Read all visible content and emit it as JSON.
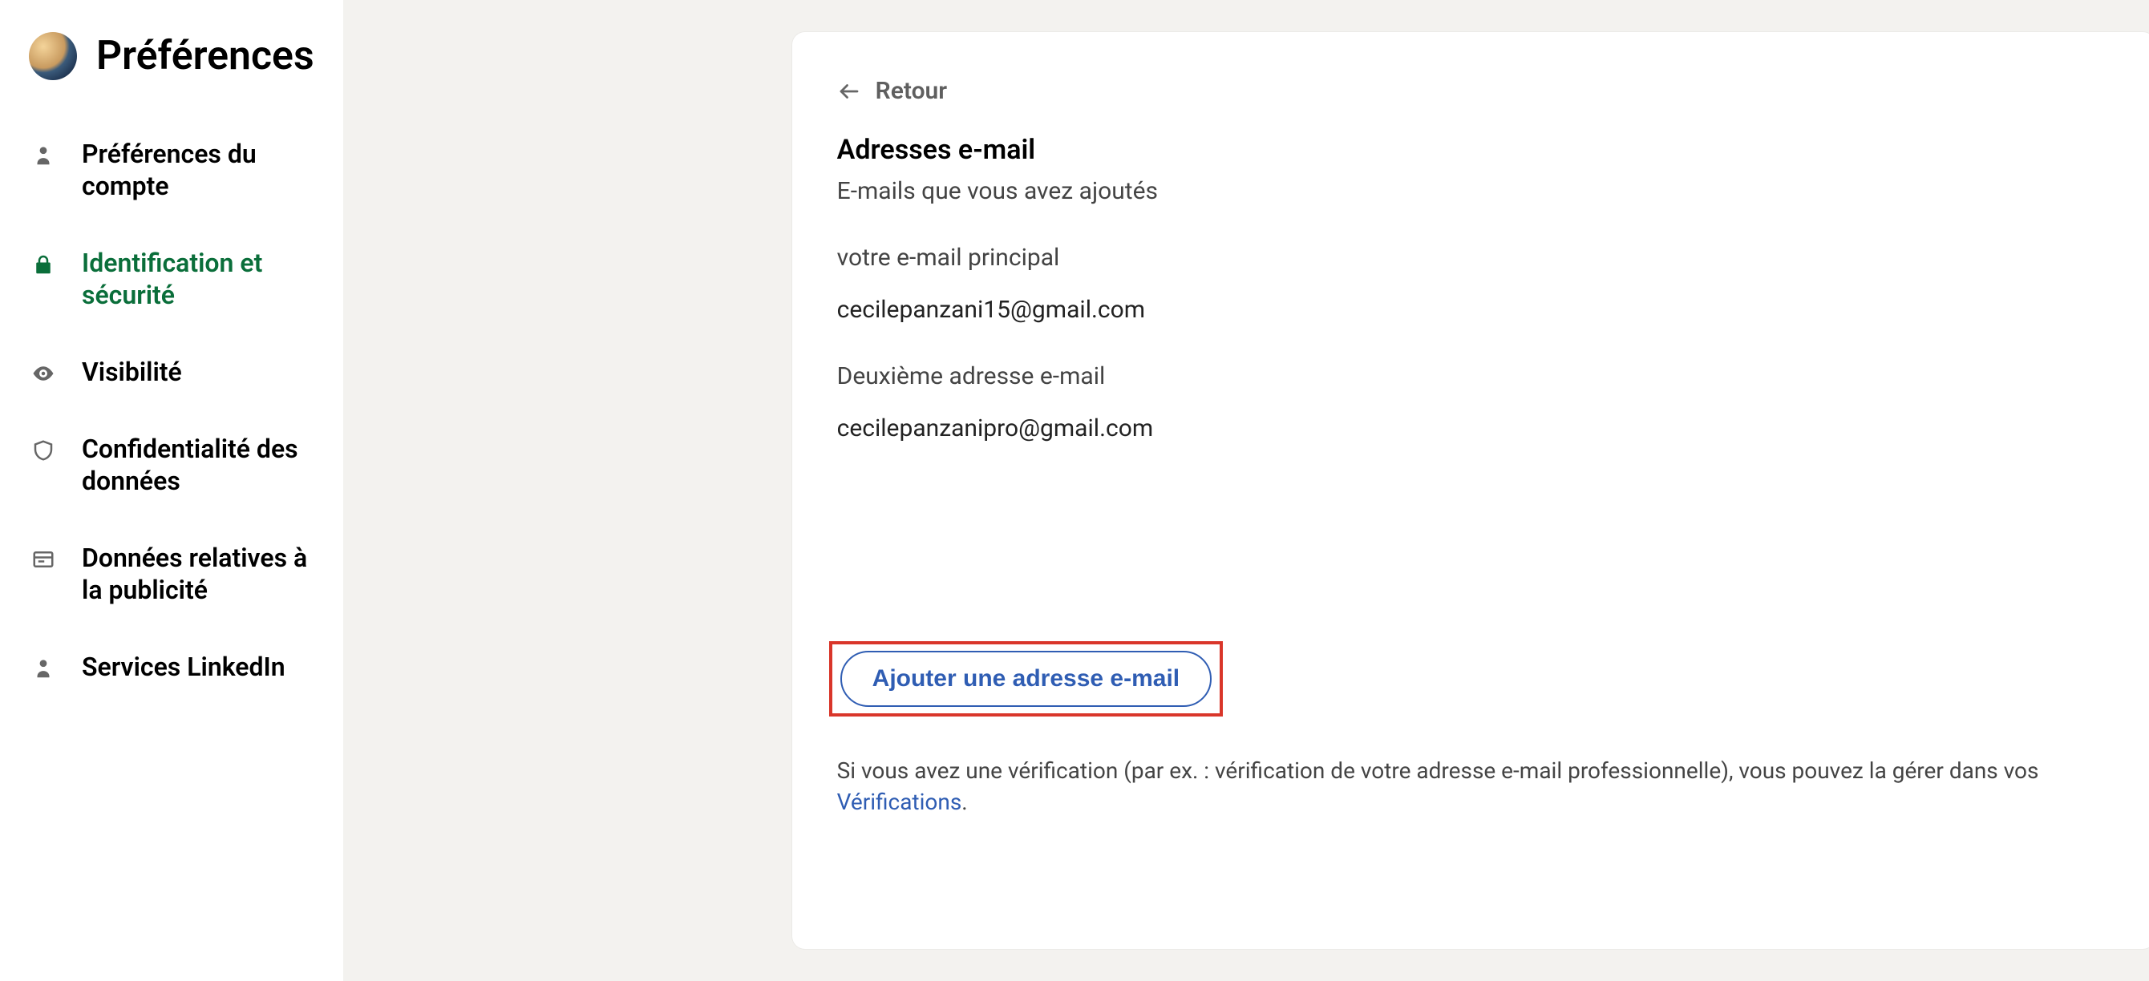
{
  "page_title": "Préférences",
  "sidebar": {
    "items": [
      {
        "label": "Préférences du compte"
      },
      {
        "label": "Identification et sécurité"
      },
      {
        "label": "Visibilité"
      },
      {
        "label": "Confidentialité des données"
      },
      {
        "label": "Données relatives à la publicité"
      },
      {
        "label": "Services LinkedIn"
      }
    ]
  },
  "main": {
    "back_label": "Retour",
    "title": "Adresses e-mail",
    "subtitle": "E-mails que vous avez ajoutés",
    "primary_label": "votre e-mail principal",
    "primary_value": "cecilepanzani15@gmail.com",
    "secondary_label": "Deuxième adresse e-mail",
    "secondary_value": "cecilepanzanipro@gmail.com",
    "add_button": "Ajouter une adresse e-mail",
    "footer_pre": "Si vous avez une vérification (par ex. : vérification de votre adresse e-mail professionnelle), vous pouvez la gérer dans vos ",
    "footer_link": "Vérifications",
    "footer_post": "."
  }
}
